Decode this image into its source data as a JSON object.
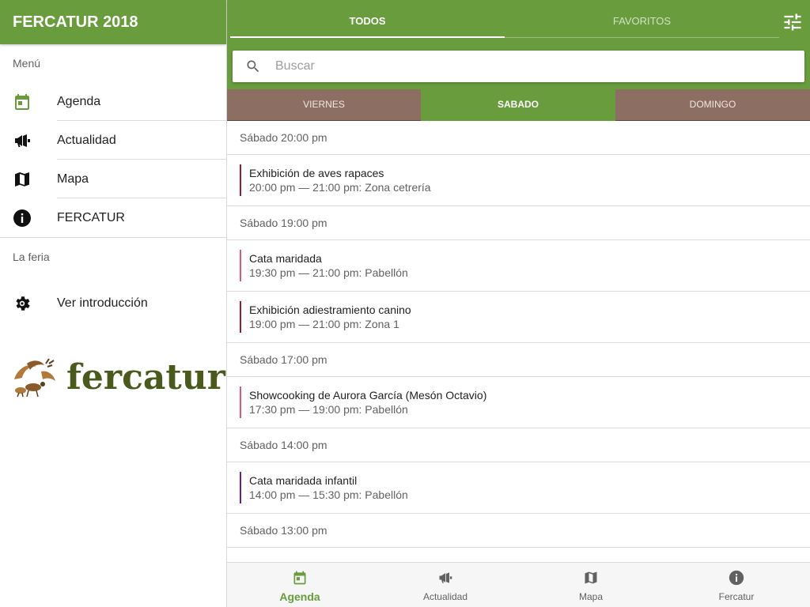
{
  "drawer": {
    "title": "FERCATUR 2018",
    "menu_section": "Menú",
    "items": [
      {
        "label": "Agenda",
        "icon": "calendar-icon"
      },
      {
        "label": "Actualidad",
        "icon": "megaphone-icon"
      },
      {
        "label": "Mapa",
        "icon": "map-icon"
      },
      {
        "label": "FERCATUR",
        "icon": "info-icon"
      }
    ],
    "feria_section": "La feria",
    "intro_item": {
      "label": "Ver introducción",
      "icon": "gear-icon"
    },
    "logo_text": "fercatur"
  },
  "tabs": {
    "todos": "TODOS",
    "favoritos": "FAVORITOS",
    "active": "TODOS"
  },
  "search": {
    "placeholder": "Buscar",
    "value": ""
  },
  "days": {
    "viernes": "VIERNES",
    "sabado": "SABADO",
    "domingo": "DOMINGO",
    "active": "SABADO"
  },
  "agenda": {
    "groups": [
      {
        "header": "Sábado 20:00 pm",
        "events": [
          {
            "title": "Exhibición de aves rapaces",
            "detail": "20:00 pm — 21:00 pm: Zona cetrería",
            "color": "#9b1b30"
          }
        ]
      },
      {
        "header": "Sábado 19:00 pm",
        "events": [
          {
            "title": "Cata maridada",
            "detail": "19:30 pm — 21:00 pm: Pabellón",
            "color": "#e05a6d"
          },
          {
            "title": "Exhibición adiestramiento canino",
            "detail": "19:00 pm — 21:00 pm: Zona 1",
            "color": "#9b1b30"
          }
        ]
      },
      {
        "header": "Sábado 17:00 pm",
        "events": [
          {
            "title": "Showcooking de Aurora García (Mesón Octavio)",
            "detail": "17:30 pm — 19:00 pm: Pabellón",
            "color": "#e05a6d"
          }
        ]
      },
      {
        "header": "Sábado 14:00 pm",
        "events": [
          {
            "title": "Cata maridada infantil",
            "detail": "14:00 pm — 15:30 pm: Pabellón",
            "color": "#6a1b9a"
          }
        ]
      },
      {
        "header": "Sábado 13:00 pm",
        "events": []
      }
    ]
  },
  "bottom_nav": [
    {
      "label": "Agenda",
      "icon": "calendar-icon",
      "active": true
    },
    {
      "label": "Actualidad",
      "icon": "megaphone-icon",
      "active": false
    },
    {
      "label": "Mapa",
      "icon": "map-icon",
      "active": false
    },
    {
      "label": "Fercatur",
      "icon": "info-icon",
      "active": false
    }
  ],
  "colors": {
    "primary": "#689c3c",
    "day_tab": "#8d6e63",
    "text": "#212121",
    "secondary_text": "#616161"
  }
}
